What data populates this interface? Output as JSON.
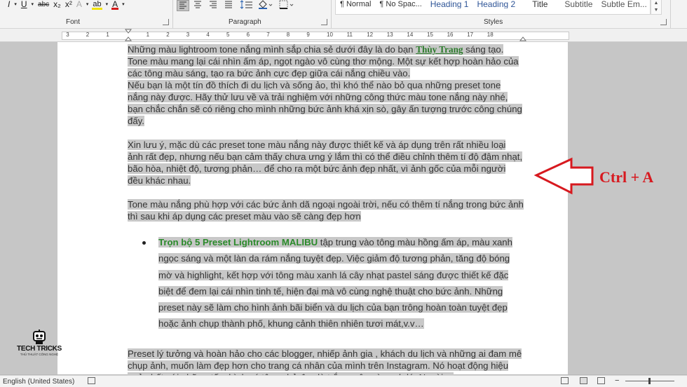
{
  "ribbon": {
    "font_buttons": {
      "italic": "I",
      "underline": "U",
      "strike": "abc",
      "subscript": "x₂",
      "superscript": "x²",
      "text_effects": "A",
      "highlight": "ab",
      "font_color": "A"
    },
    "groups": {
      "font": "Font",
      "paragraph": "Paragraph",
      "styles": "Styles"
    },
    "styles": [
      "¶ Normal",
      "¶ No Spac...",
      "Heading 1",
      "Heading 2",
      "Title",
      "Subtitle",
      "Subtle Em..."
    ],
    "colors": {
      "highlight_bar": "#f2e400",
      "font_color_bar": "#d51a1a"
    }
  },
  "ruler": {
    "numbers": [
      "3",
      "2",
      "1",
      "1",
      "2",
      "3",
      "4",
      "5",
      "6",
      "7",
      "8",
      "9",
      "10",
      "11",
      "12",
      "13",
      "14",
      "15",
      "16",
      "17",
      "18"
    ]
  },
  "document": {
    "p1_a": "Những màu lightroom tone nắng mình sắp chia sẻ dưới đây là do bạn ",
    "p1_name": "Thùy Trang",
    "p1_b": " sáng tạo.",
    "p2": "Tone màu mang lại cái nhìn ấm áp, ngọt ngào vô cùng thơ mộng. Một sự kết hợp hoàn hảo của các tông màu sáng, tạo ra bức ảnh cực đẹp giữa cái nắng chiều vào.",
    "p3": "Nếu bạn là một tín đồ thích đi du lịch và sống ảo, thì khó thể nào bỏ qua những preset tone nắng này được. Hãy thử lưu về và trải nghiệm với những công thức màu tone nắng này nhé, bạn chắc chắn sẽ có riêng cho mình những bức ảnh khá xịn sò, gây ấn tượng trước công chúng đấy.",
    "p4": "Xin lưu ý, mặc dù các preset tone màu nắng này được thiết kế và áp dụng trên rất nhiều loại ảnh rất đẹp, nhưng nếu bạn cảm thấy chưa ưng ý lắm thì có thể điều chỉnh thêm tí độ đậm nhạt, bão hòa, nhiệt độ, tương phản… để cho ra một bức ảnh đẹp nhất, vì ảnh gốc của mỗi người đều khác nhau.",
    "p5": "Tone màu nắng phù hợp với các bức ảnh dã ngoại ngoài trời, nếu có thêm tí nắng trong bức ảnh thì sau khi áp dụng các preset màu vào sẽ càng đẹp hơn",
    "bullet_title": "Trọn bộ 5 Preset Lightroom MALIBU",
    "bullet_text": " tập trung vào tông màu hồng ấm áp, màu xanh ngọc sáng và một làn da rám nắng tuyệt đẹp. Việc giảm độ tương phản, tăng độ bóng mờ và highlight, kết hợp với tông màu xanh lá cây nhạt pastel sáng được thiết kế đặc biệt để đem lại cái nhìn tinh tế, hiện đại mà vô cùng nghệ thuật cho bức ảnh.  Những preset này sẽ làm cho hình ảnh bãi biển và du lịch của bạn trông hoàn toàn tuyệt đẹp hoặc ảnh chụp thành phố, khung cảnh thiên nhiên tươi mát,v.v…",
    "p6": "Preset lý tưởng và hoàn hảo cho các blogger, nhiếp ảnh gia , khách du lịch và những ai đam mê chụp ảnh, muốn làm đẹp hơn cho trang cá nhân của mình trên Instagram. Nó hoạt động hiệu quả nhất với những tấm hình có tông chủ đạo là trắng, nâu và xanh lá. Ngoài ra"
  },
  "annotation": {
    "label": "Ctrl + A",
    "color": "#d7191f"
  },
  "logo": {
    "name": "TECH TRICKS",
    "tagline": "THỦ THUẬT CÔNG NGHỆ"
  },
  "status": {
    "language": "English (United States)"
  }
}
